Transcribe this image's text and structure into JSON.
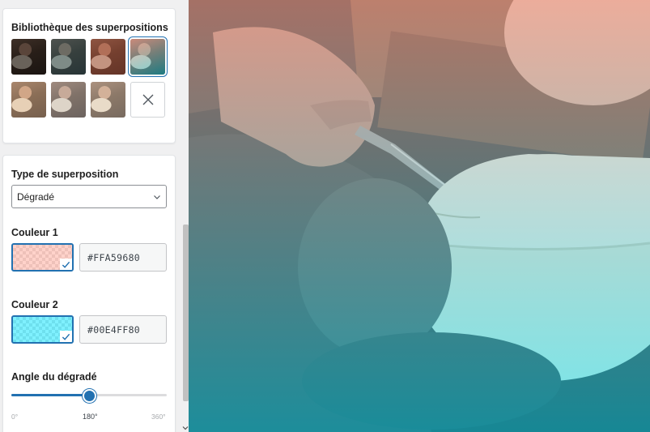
{
  "library": {
    "title": "Bibliothèque des superpositions",
    "swatches": [
      {
        "name": "dark",
        "tint": "rgba(0,0,0,0.55)"
      },
      {
        "name": "teal-dark",
        "tint": "rgba(20,60,70,0.5)"
      },
      {
        "name": "red-brown",
        "tint": "rgba(150,60,40,0.45)"
      },
      {
        "name": "peach-teal",
        "tint": "linear-gradient(160deg,rgba(255,165,150,0.55),rgba(0,200,220,0.5))"
      },
      {
        "name": "warm-light",
        "tint": "rgba(230,190,150,0.35)"
      },
      {
        "name": "grey-light",
        "tint": "rgba(200,200,200,0.35)"
      },
      {
        "name": "beige-light",
        "tint": "rgba(235,220,200,0.35)"
      },
      {
        "name": "none",
        "icon": "close-icon"
      }
    ],
    "selected_index": 3
  },
  "settings": {
    "overlay_type_label": "Type de superposition",
    "overlay_type_value": "Dégradé",
    "color1_label": "Couleur 1",
    "color1_hex": "#FFA59680",
    "color1_swatch": "rgba(255,165,150,0.5)",
    "color2_label": "Couleur 2",
    "color2_hex": "#00E4FF80",
    "color2_swatch": "rgba(0,228,255,0.5)",
    "angle_label": "Angle du dégradé",
    "angle_value": 180,
    "angle_min": 0,
    "angle_max": 360,
    "angle_min_label": "0°",
    "angle_mid_label": "180°",
    "angle_max_label": "360°"
  },
  "colors": {
    "accent": "#2271b1"
  }
}
